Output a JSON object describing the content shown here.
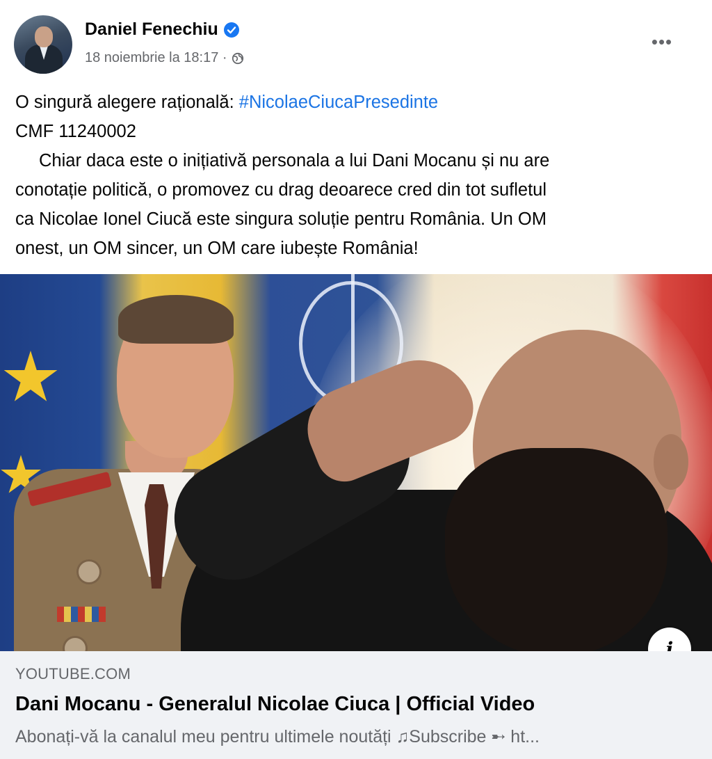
{
  "post": {
    "author": "Daniel Fenechiu",
    "timestamp": "18 noiembrie la 18:17 ·",
    "more_icon": "more-horizontal-icon",
    "text_line1_prefix": "O singură alegere rațională: ",
    "hashtag": "#NicolaeCiucaPresedinte",
    "text_line2": "CMF 11240002",
    "text_line3": "Chiar daca este o inițiativă personala a lui Dani Mocanu și nu are",
    "text_line4": "conotație politică, o promovez cu drag deoarece cred din tot sufletul",
    "text_line5": "ca Nicolae Ionel Ciucă este singura soluție pentru România. Un OM",
    "text_line6": "onest, un OM sincer, un OM care iubește România!"
  },
  "link_preview": {
    "domain": "YOUTUBE.COM",
    "title": "Dani Mocanu - Generalul Nicolae Ciuca | Official Video",
    "description": "Abonați-vă la canalul meu pentru ultimele noutăți ♫Subscribe ➸ ht...",
    "info_label": "i"
  },
  "colors": {
    "hashtag": "#1b74e4",
    "verified_badge": "#1877f2",
    "secondary_text": "#65676b",
    "preview_bg": "#f0f2f5"
  }
}
